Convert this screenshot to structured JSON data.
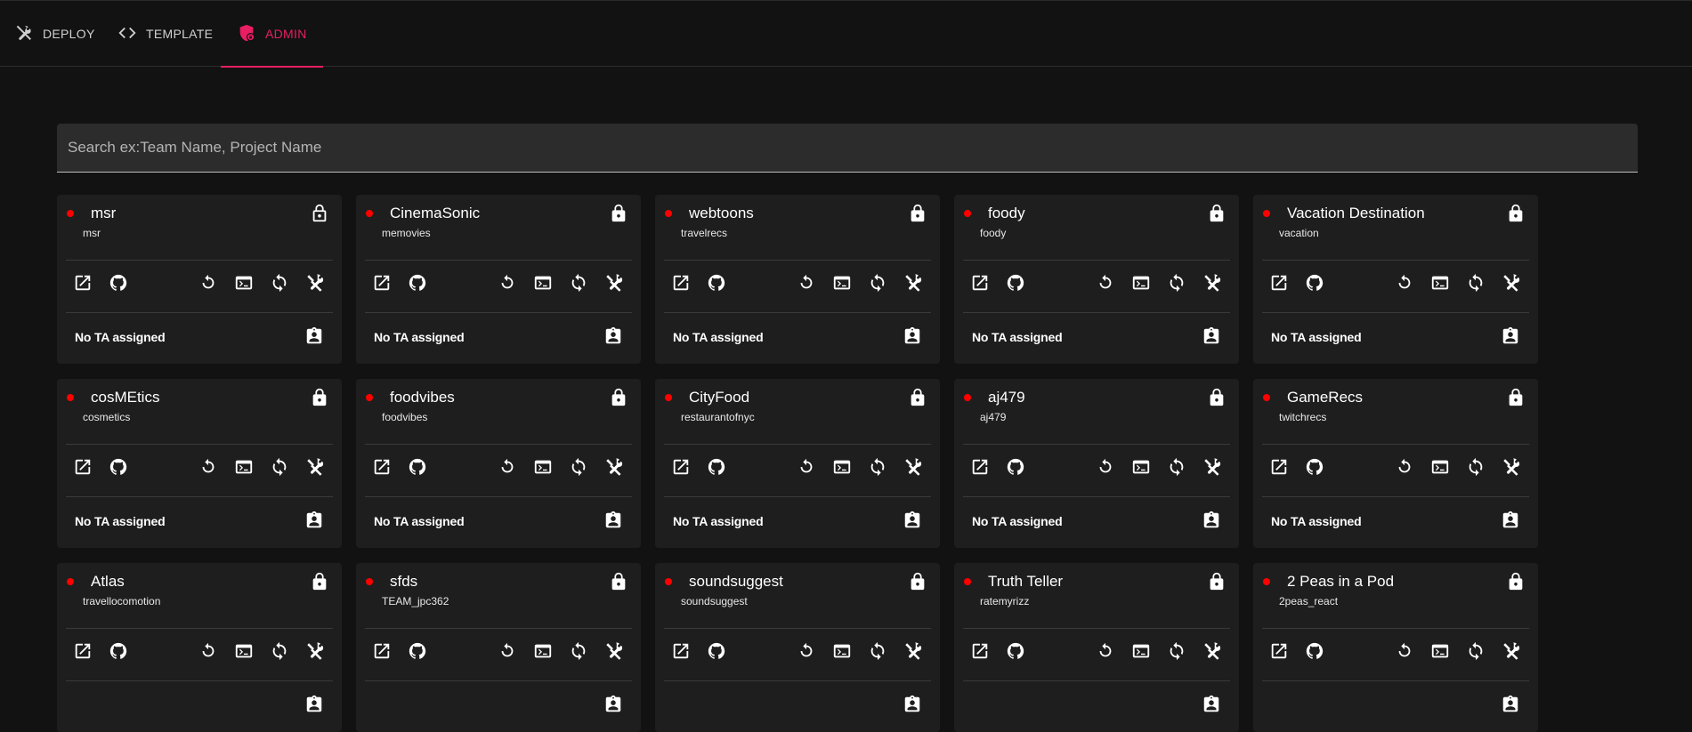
{
  "nav": {
    "tabs": [
      {
        "label": "DEPLOY",
        "icon": "hammer-wrench-icon"
      },
      {
        "label": "TEMPLATE",
        "icon": "code-icon"
      },
      {
        "label": "ADMIN",
        "icon": "shield-lock-icon"
      }
    ],
    "active_tab": "ADMIN",
    "accent_color": "#e91e63"
  },
  "search": {
    "placeholder": "Search ex:Team Name, Project Name",
    "value": ""
  },
  "colors": {
    "status_dot": "#ff0000",
    "card_bg": "#1e1e1e",
    "page_bg": "#121212"
  },
  "projects": [
    {
      "name": "msr",
      "sub": "msr",
      "lock": "unlocked",
      "ta": "No TA assigned"
    },
    {
      "name": "CinemaSonic",
      "sub": "memovies",
      "lock": "locked",
      "ta": "No TA assigned"
    },
    {
      "name": "webtoons",
      "sub": "travelrecs",
      "lock": "locked",
      "ta": "No TA assigned"
    },
    {
      "name": "foody",
      "sub": "foody",
      "lock": "locked",
      "ta": "No TA assigned"
    },
    {
      "name": "Vacation Destination",
      "sub": "vacation",
      "lock": "locked",
      "ta": "No TA assigned"
    },
    {
      "name": "cosMEtics",
      "sub": "cosmetics",
      "lock": "locked",
      "ta": "No TA assigned"
    },
    {
      "name": "foodvibes",
      "sub": "foodvibes",
      "lock": "locked",
      "ta": "No TA assigned"
    },
    {
      "name": "CityFood",
      "sub": "restaurantofnyc",
      "lock": "locked",
      "ta": "No TA assigned"
    },
    {
      "name": "aj479",
      "sub": "aj479",
      "lock": "locked",
      "ta": "No TA assigned"
    },
    {
      "name": "GameRecs",
      "sub": "twitchrecs",
      "lock": "locked",
      "ta": "No TA assigned"
    },
    {
      "name": "Atlas",
      "sub": "travellocomotion",
      "lock": "locked",
      "ta": ""
    },
    {
      "name": "sfds",
      "sub": "TEAM_jpc362",
      "lock": "locked",
      "ta": ""
    },
    {
      "name": "soundsuggest",
      "sub": "soundsuggest",
      "lock": "locked",
      "ta": ""
    },
    {
      "name": "Truth Teller",
      "sub": "ratemyrizz",
      "lock": "locked",
      "ta": ""
    },
    {
      "name": "2 Peas in a Pod",
      "sub": "2peas_react",
      "lock": "locked",
      "ta": ""
    }
  ],
  "card_actions": [
    "open-external-icon",
    "github-icon",
    "restart-icon",
    "terminal-icon",
    "sync-icon",
    "build-icon"
  ]
}
